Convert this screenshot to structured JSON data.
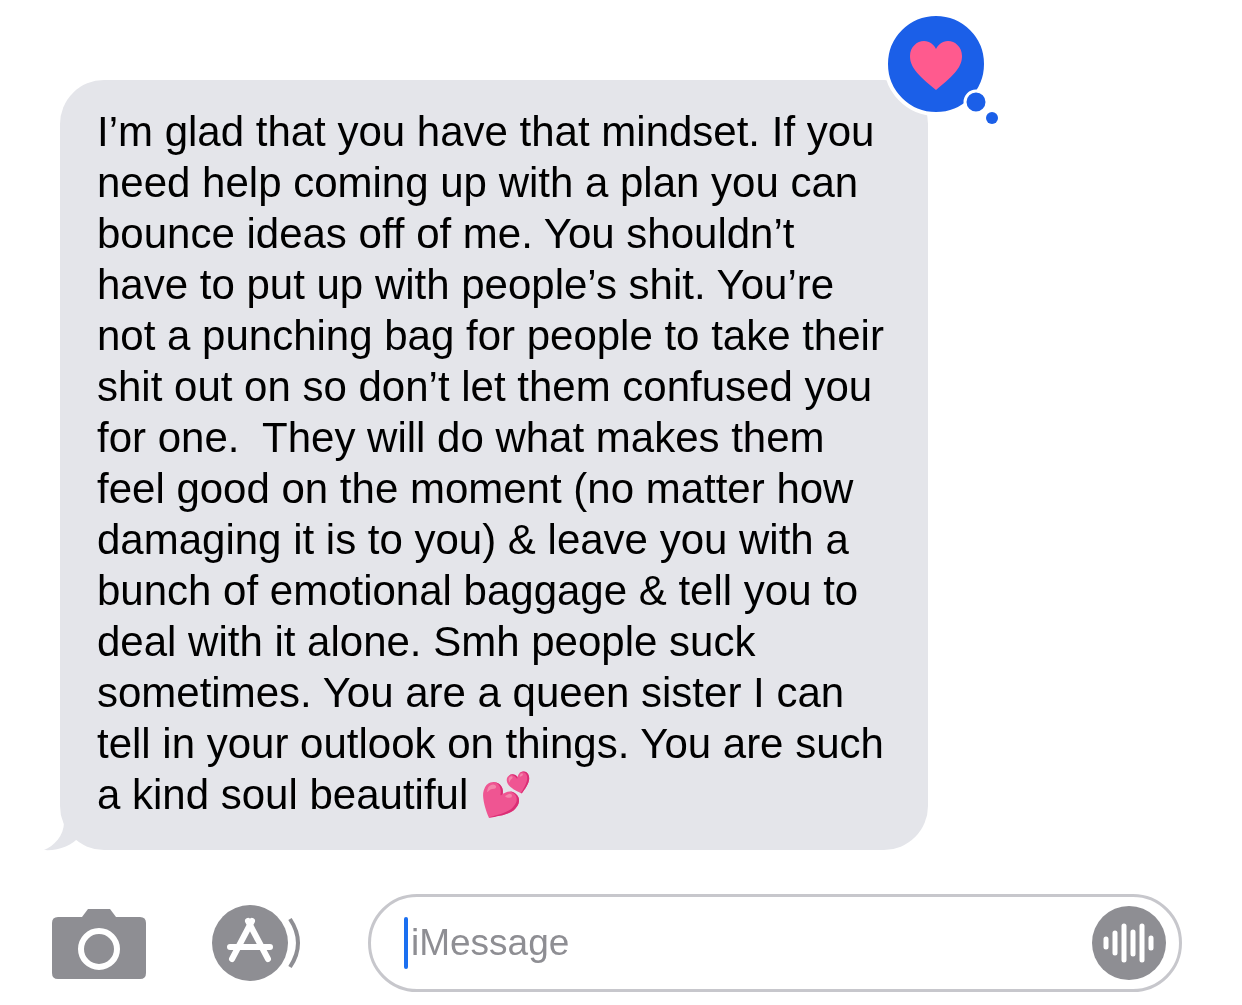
{
  "message": {
    "text": "I’m glad that you have that mindset. If you\nneed help coming up with a plan you can\nbounce ideas off of me. You shouldn’t\nhave to put up with people’s shit. You’re\nnot a punching bag for people to take their\nshit out on so don’t let them confused you\nfor one.  They will do what makes them\nfeel good on the moment (no matter how\ndamaging it is to you) & leave you with a\nbunch of emotional baggage & tell you to\ndeal with it alone. Smh people suck\nsometimes. You are a queen sister I can\ntell in your outlook on things. You are such\na kind soul beautiful 💕"
  },
  "composer": {
    "placeholder": "iMessage"
  }
}
